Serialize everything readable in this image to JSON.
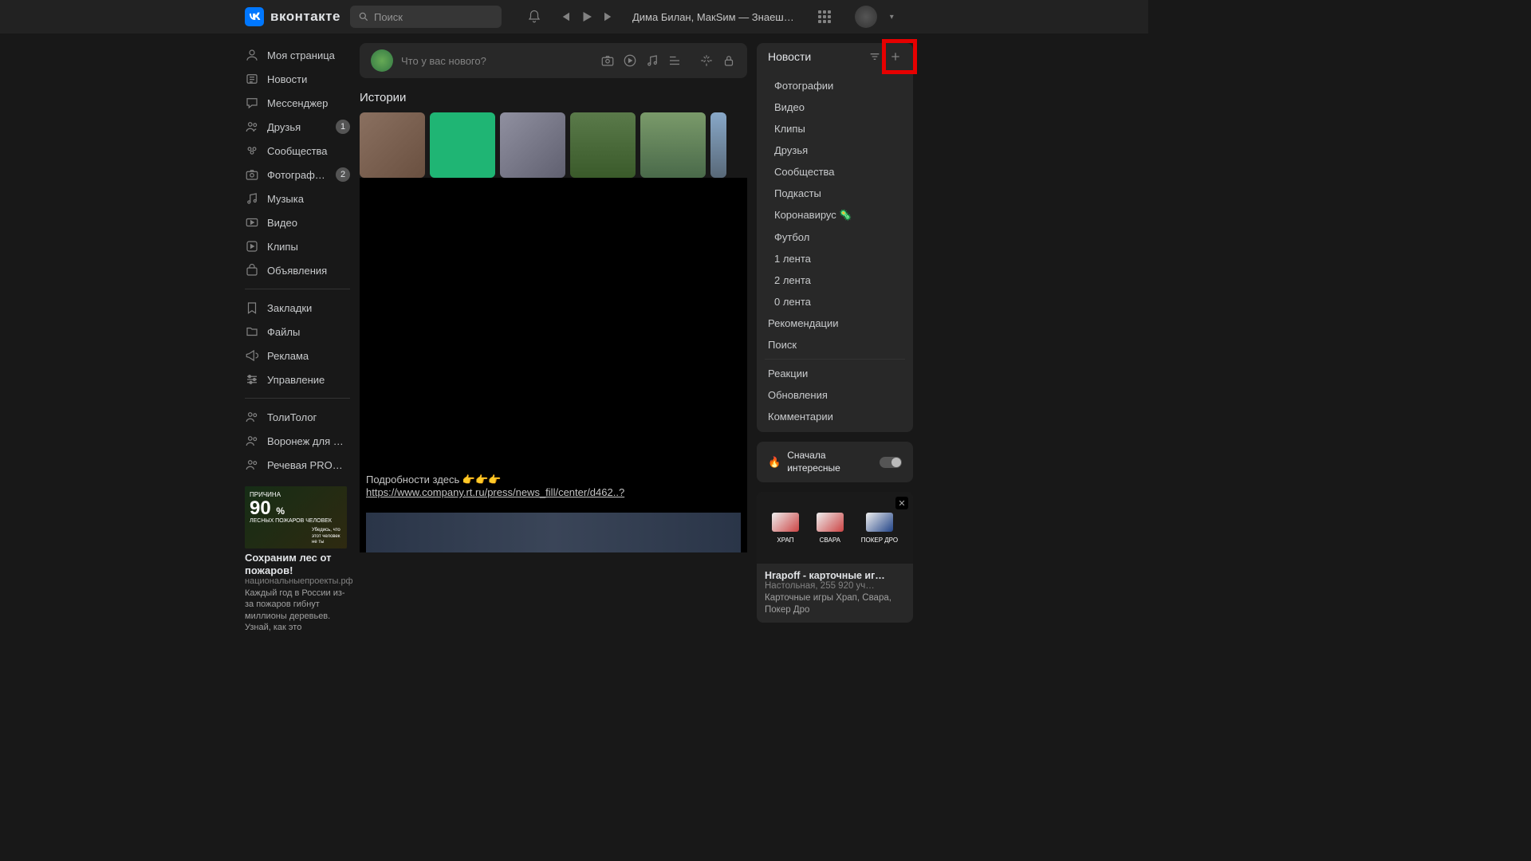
{
  "header": {
    "brand": "вконтакте",
    "search": "Поиск",
    "nowplaying": "Дима Билан, МакSим — Знаеш…"
  },
  "nav": {
    "items": [
      {
        "id": "my-page",
        "label": "Моя страница"
      },
      {
        "id": "news",
        "label": "Новости"
      },
      {
        "id": "messenger",
        "label": "Мессенджер"
      },
      {
        "id": "friends",
        "label": "Друзья",
        "badge": "1"
      },
      {
        "id": "groups",
        "label": "Сообщества"
      },
      {
        "id": "photos",
        "label": "Фотограф…",
        "badge": "2"
      },
      {
        "id": "music",
        "label": "Музыка"
      },
      {
        "id": "video",
        "label": "Видео"
      },
      {
        "id": "clips",
        "label": "Клипы"
      },
      {
        "id": "market",
        "label": "Объявления"
      }
    ],
    "secondary": [
      {
        "id": "bookmarks",
        "label": "Закладки"
      },
      {
        "id": "files",
        "label": "Файлы"
      },
      {
        "id": "advert",
        "label": "Реклама"
      },
      {
        "id": "manage",
        "label": "Управление"
      }
    ],
    "tertiary": [
      {
        "id": "tolitolog",
        "label": "ТолиТолог"
      },
      {
        "id": "voronezh",
        "label": "Воронеж для …"
      },
      {
        "id": "rechevaya",
        "label": "Речевая PRO…"
      }
    ]
  },
  "leftad": {
    "img_top": "ПРИЧИНА",
    "img_big": "90",
    "img_unit": "%",
    "img_sub": "ЛЕСНЫХ ПОЖАРОВ ЧЕЛОВЕК",
    "img_hint": "Убедись, что этот человек не ты",
    "title": "Сохраним лес от пожаров!",
    "sub": "национальныепроекты.рф",
    "text": "Каждый год в России из-за пожаров гибнут миллионы деревьев. Узнай, как это"
  },
  "compose": {
    "placeholder": "Что у вас нового?"
  },
  "stories": {
    "title": "Истории"
  },
  "post": {
    "link_prefix": "Подробности здесь 👉👉👉",
    "url": "https://www.company.rt.ru/press/news_fill/center/d462..?"
  },
  "news": {
    "title": "Новости",
    "items": [
      {
        "label": "Фотографии",
        "sub": true
      },
      {
        "label": "Видео",
        "sub": true
      },
      {
        "label": "Клипы",
        "sub": true
      },
      {
        "label": "Друзья",
        "sub": true
      },
      {
        "label": "Сообщества",
        "sub": true
      },
      {
        "label": "Подкасты",
        "sub": true
      },
      {
        "label": "Коронавирус 🦠",
        "sub": true
      },
      {
        "label": "Футбол",
        "sub": true
      },
      {
        "label": "1 лента",
        "sub": true
      },
      {
        "label": "2 лента",
        "sub": true
      },
      {
        "label": "0 лента",
        "sub": true
      },
      {
        "label": "Рекомендации"
      },
      {
        "label": "Поиск"
      },
      {
        "div": true
      },
      {
        "label": "Реакции"
      },
      {
        "label": "Обновления"
      },
      {
        "label": "Комментарии"
      }
    ]
  },
  "sort": {
    "label": "Сначала интересные",
    "icon": "🔥"
  },
  "ad2": {
    "cards": [
      "ХРАП",
      "СВАРА",
      "ПОКЕР ДРО"
    ],
    "title": "Hrapoff - карточные иг…",
    "sub": "Настольная, 255 920 уч…",
    "text": "Карточные игры Храп, Свара, Покер Дро"
  }
}
